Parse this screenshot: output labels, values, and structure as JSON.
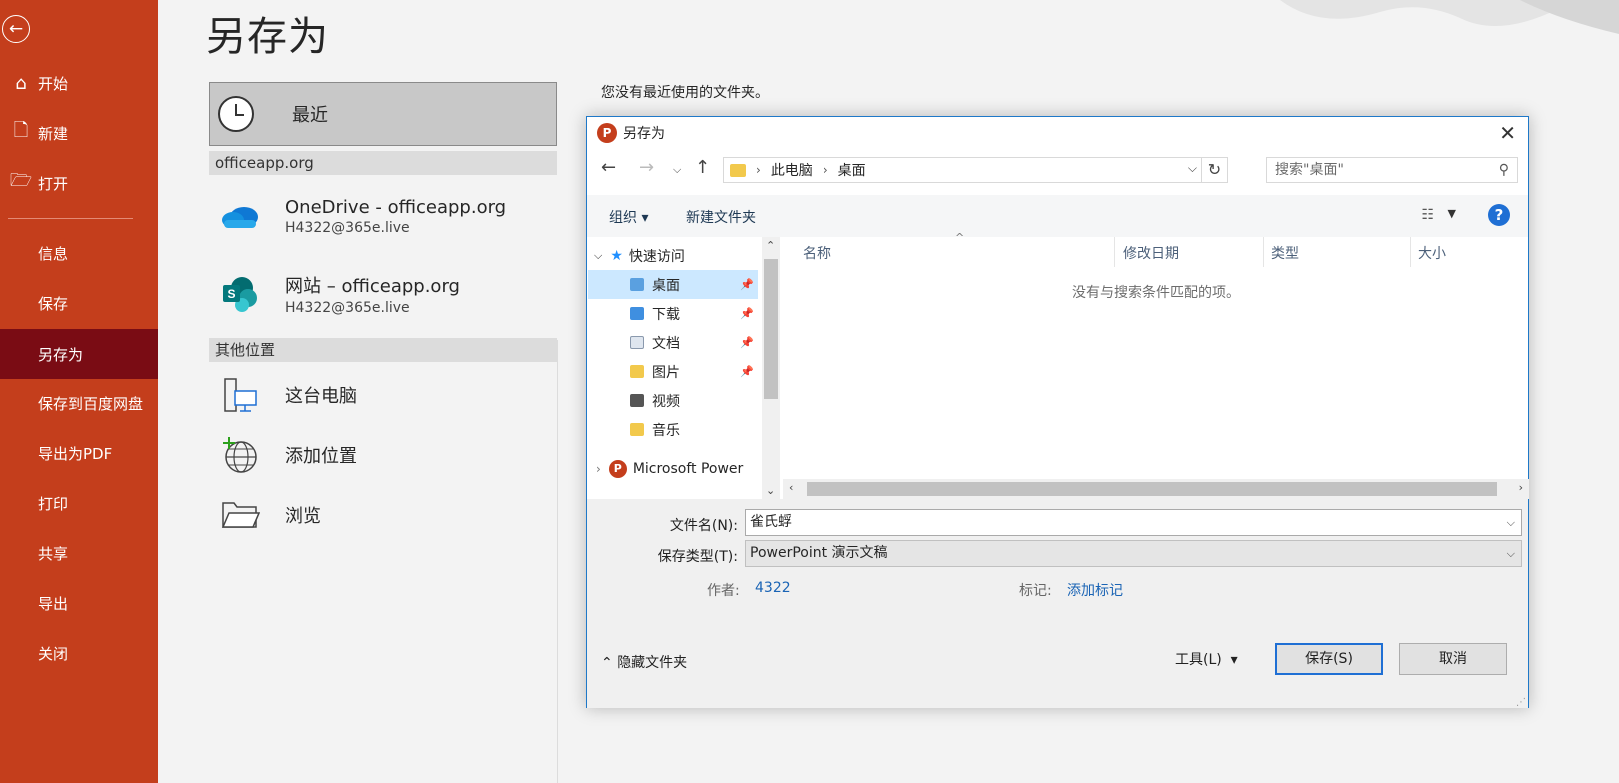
{
  "sidebar": {
    "items": [
      {
        "label": "开始",
        "icon": "home-icon"
      },
      {
        "label": "新建",
        "icon": "new-doc-icon"
      },
      {
        "label": "打开",
        "icon": "folder-open-icon"
      },
      {
        "label": "信息"
      },
      {
        "label": "保存"
      },
      {
        "label": "另存为"
      },
      {
        "label": "保存到百度网盘"
      },
      {
        "label": "导出为PDF"
      },
      {
        "label": "打印"
      },
      {
        "label": "共享"
      },
      {
        "label": "导出"
      },
      {
        "label": "关闭"
      }
    ],
    "active": "另存为",
    "color": "#c43e1c",
    "active_color": "#7a0c14"
  },
  "page": {
    "title": "另存为",
    "no_recent_msg": "您没有最近使用的文件夹。"
  },
  "locations": {
    "recent": "最近",
    "group1": "officeapp.org",
    "onedrive": {
      "name": "OneDrive - officeapp.org",
      "account": "H4322@365e.live"
    },
    "site": {
      "name": "网站 – officeapp.org",
      "account": "H4322@365e.live"
    },
    "group2": "其他位置",
    "this_pc": "这台电脑",
    "add_place": "添加位置",
    "browse": "浏览"
  },
  "dialog": {
    "title": "另存为",
    "breadcrumb": [
      "此电脑",
      "桌面"
    ],
    "search_placeholder": "搜索\"桌面\"",
    "toolbar": {
      "organize": "组织",
      "new_folder": "新建文件夹"
    },
    "tree": [
      {
        "label": "快速访问"
      },
      {
        "label": "桌面"
      },
      {
        "label": "下载"
      },
      {
        "label": "文档"
      },
      {
        "label": "图片"
      },
      {
        "label": "视频"
      },
      {
        "label": "音乐"
      },
      {
        "label": "Microsoft Power"
      }
    ],
    "columns": [
      "名称",
      "修改日期",
      "类型",
      "大小"
    ],
    "empty_msg": "没有与搜索条件匹配的项。",
    "filename_label": "文件名(N):",
    "filename_value": "雀氏蜉",
    "filetype_label": "保存类型(T):",
    "filetype_value": "PowerPoint 演示文稿",
    "author_label": "作者:",
    "author_value": "4322",
    "tags_label": "标记:",
    "tags_value": "添加标记",
    "hide_folders": "隐藏文件夹",
    "tools": "工具(L)",
    "save": "保存(S)",
    "cancel": "取消"
  }
}
